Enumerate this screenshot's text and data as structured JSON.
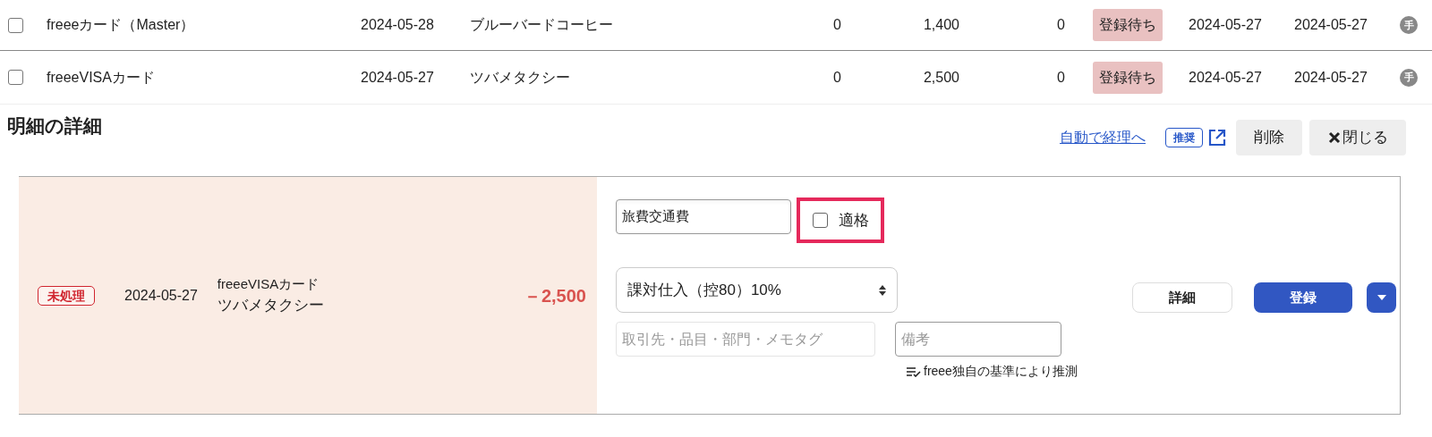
{
  "transactions": [
    {
      "checked": false,
      "account": "freeeカード（Master）",
      "date": "2024-05-28",
      "payee": "ブルーバードコーヒー",
      "column_4": "0",
      "amount": "1,400",
      "column_6": "0",
      "status": "登録待ち",
      "column_8": "2024-05-27",
      "column_9": "2024-05-27",
      "badge": "手"
    },
    {
      "checked": false,
      "account": "freeeVISAカード",
      "date": "2024-05-27",
      "payee": "ツバメタクシー",
      "column_4": "0",
      "amount": "2,500",
      "column_6": "0",
      "status": "登録待ち",
      "column_8": "2024-05-27",
      "column_9": "2024-05-27",
      "badge": "手"
    }
  ],
  "detail": {
    "title": "明細の詳細",
    "auto_link": "自動で経理へ",
    "recommended_badge": "推奨",
    "delete_button": "削除",
    "close_button": "閉じる",
    "entry": {
      "status": "未処理",
      "date": "2024-05-27",
      "account": "freeeVISAカード",
      "payee": "ツバメタクシー",
      "amount": "－2,500"
    },
    "form": {
      "account_item": "旅費交通費",
      "qualified": {
        "label": "適格",
        "checked": false,
        "highlighted": true
      },
      "tax_select": "課対仕入（控80）10%",
      "tags_placeholder": "取引先・品目・部門・メモタグ",
      "memo_placeholder": "備考",
      "hint": "freee独自の基準により推測",
      "detail_button": "詳細",
      "register_button": "登録"
    }
  }
}
